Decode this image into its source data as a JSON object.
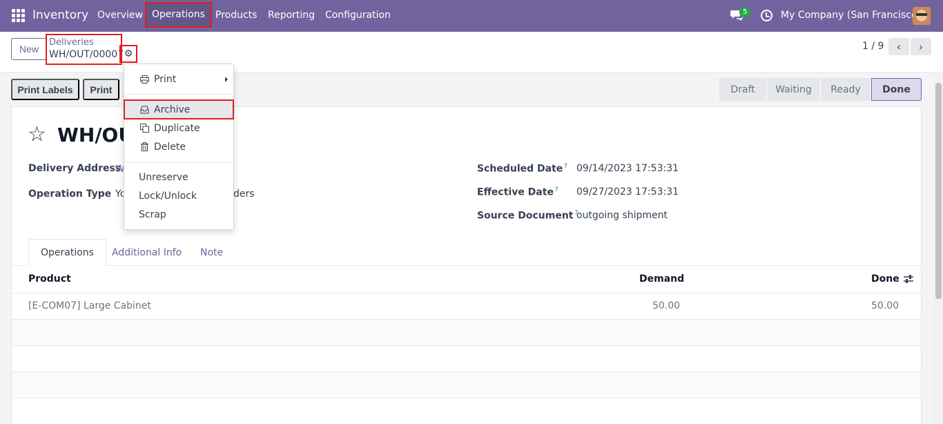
{
  "navbar": {
    "app_name": "Inventory",
    "menu": [
      "Overview",
      "Operations",
      "Products",
      "Reporting",
      "Configuration"
    ],
    "messages_badge": "5",
    "company": "My Company (San Francisco)"
  },
  "control": {
    "new_label": "New",
    "breadcrumb_parent": "Deliveries",
    "breadcrumb_current": "WH/OUT/00007",
    "pager": "1 / 9"
  },
  "actions": {
    "print_labels": "Print Labels",
    "print": "Print"
  },
  "statusbar": {
    "steps": [
      "Draft",
      "Waiting",
      "Ready",
      "Done"
    ],
    "active": "Done"
  },
  "form": {
    "title": "WH/OU",
    "delivery_address_label": "Delivery Address",
    "delivery_address_value": "W",
    "operation_type_label": "Operation Type",
    "operation_type_value_start": "Yo",
    "operation_type_value_end": "ders",
    "scheduled_date_label": "Scheduled Date",
    "scheduled_date_value": "09/14/2023 17:53:31",
    "effective_date_label": "Effective Date",
    "effective_date_value": "09/27/2023 17:53:31",
    "source_document_label": "Source Document",
    "source_document_value": "outgoing shipment",
    "help_mark": "?"
  },
  "tabs": [
    "Operations",
    "Additional Info",
    "Note"
  ],
  "table": {
    "headers": [
      "Product",
      "Demand",
      "Done"
    ],
    "rows": [
      {
        "product": "[E-COM07] Large Cabinet",
        "demand": "50.00",
        "done": "50.00"
      }
    ]
  },
  "gear_menu": {
    "print": "Print",
    "archive": "Archive",
    "duplicate": "Duplicate",
    "delete": "Delete",
    "unreserve": "Unreserve",
    "lock_unlock": "Lock/Unlock",
    "scrap": "Scrap"
  },
  "colors": {
    "brand": "#71639e",
    "highlight": "#e11d1d",
    "link": "#71639e"
  }
}
